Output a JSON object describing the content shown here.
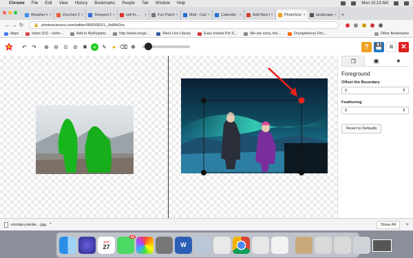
{
  "menubar": {
    "app": "Chrome",
    "items": [
      "File",
      "Edit",
      "View",
      "History",
      "Bookmarks",
      "People",
      "Tab",
      "Window",
      "Help"
    ],
    "clock": "Mon 10:13 AM"
  },
  "tabs": [
    {
      "label": "Weather Ha",
      "color": "#3b8ee8"
    },
    {
      "label": "Zucchini G",
      "color": "#e85b3b"
    },
    {
      "label": "Simpson D",
      "color": "#2b6cd6"
    },
    {
      "label": "sell th...",
      "color": "#e53030"
    },
    {
      "label": "Fun Patchw",
      "color": "#777777"
    },
    {
      "label": "Mail - Carl",
      "color": "#1f6fd1"
    },
    {
      "label": "Calendar",
      "color": "#1f6fd1"
    },
    {
      "label": "Add New P",
      "color": "#d04030"
    },
    {
      "label": "PhotoScis",
      "color": "#f0a020",
      "active": true
    },
    {
      "label": "landscape",
      "color": "#555555"
    }
  ],
  "url": "photoscissors.com/editor/9959352/1_0eMhDvx",
  "bookmarks": [
    {
      "label": "Apps",
      "color": "#4a7be8"
    },
    {
      "label": "Inbox (10) - cathe...",
      "color": "#d44"
    },
    {
      "label": "Add to MyRegistry",
      "color": "#888"
    },
    {
      "label": "http://www.orego...",
      "color": "#888"
    },
    {
      "label": "West Linn Library",
      "color": "#2a5a9a"
    },
    {
      "label": "Easy Instant Pot S...",
      "color": "#c33"
    },
    {
      "label": "We are sorry, the...",
      "color": "#888"
    },
    {
      "label": "Orangetheory Fitn...",
      "color": "#f60"
    }
  ],
  "other_bookmarks": "Other Bookmarks",
  "toolbar": {
    "icons": [
      "undo-icon",
      "redo-icon",
      "zoom-in-icon",
      "zoom-out-icon",
      "zoom-fit-icon",
      "zoom-actual-icon",
      "clear-icon",
      "foreground-marker-icon",
      "eraser-icon",
      "background-marker-icon",
      "eraser-alt-icon",
      "move-icon"
    ],
    "glyphs": [
      "↶",
      "↷",
      "⊕",
      "⊖",
      "⊙",
      "⊘",
      "✖",
      "+",
      "✎",
      "●",
      "⌫",
      "✥"
    ],
    "slider_level": 0.05
  },
  "topright": [
    {
      "glyph": "?",
      "color": "#f0a020",
      "name": "help-button"
    },
    {
      "glyph": "💾",
      "color": "#1e78d2",
      "name": "save-button"
    },
    {
      "glyph": "≡",
      "color": "#ffffff",
      "name": "menu-button"
    },
    {
      "glyph": "✕",
      "color": "#e02020",
      "name": "close-editor-button"
    }
  ],
  "panel": {
    "tabs": [
      "layers-icon",
      "background-icon",
      "star-icon"
    ],
    "tab_glyphs": [
      "❐",
      "▣",
      "★"
    ],
    "title": "Foreground",
    "offset_label": "Offset the Boundary",
    "offset_value": "0",
    "feather_label": "Feathering",
    "feather_value": "0",
    "reset_label": "Reset to Defaults"
  },
  "download": {
    "filename": "nicolas-j-lecler....jpg",
    "show_all": "Show All"
  },
  "dock": {
    "calendar_month": "APR",
    "calendar_day": "27",
    "messages_badge": "58"
  }
}
